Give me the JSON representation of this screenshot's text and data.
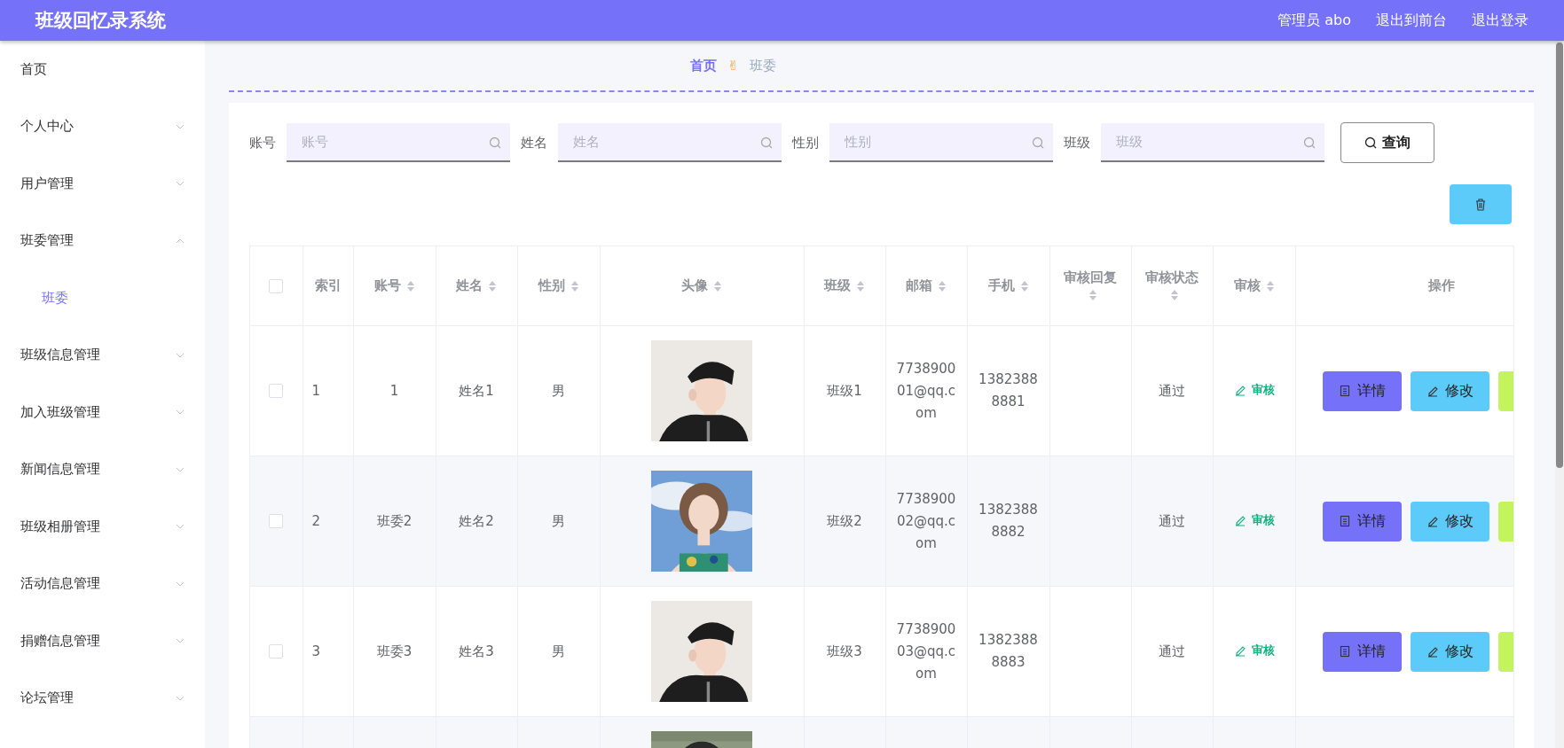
{
  "header": {
    "title": "班级回忆录系统",
    "links": [
      "管理员 abo",
      "退出到前台",
      "退出登录"
    ]
  },
  "sidebar": {
    "items": [
      {
        "label": "首页",
        "kind": "link"
      },
      {
        "label": "个人中心",
        "kind": "menu",
        "expanded": false
      },
      {
        "label": "用户管理",
        "kind": "menu",
        "expanded": false
      },
      {
        "label": "班委管理",
        "kind": "menu",
        "expanded": true,
        "children": [
          {
            "label": "班委",
            "selected": true
          }
        ]
      },
      {
        "label": "班级信息管理",
        "kind": "menu",
        "expanded": false
      },
      {
        "label": "加入班级管理",
        "kind": "menu",
        "expanded": false
      },
      {
        "label": "新闻信息管理",
        "kind": "menu",
        "expanded": false
      },
      {
        "label": "班级相册管理",
        "kind": "menu",
        "expanded": false
      },
      {
        "label": "活动信息管理",
        "kind": "menu",
        "expanded": false
      },
      {
        "label": "捐赠信息管理",
        "kind": "menu",
        "expanded": false
      },
      {
        "label": "论坛管理",
        "kind": "menu",
        "expanded": false
      }
    ]
  },
  "breadcrumb": {
    "items": [
      {
        "label": "首页",
        "selected": true
      },
      {
        "label": "班委",
        "selected": false
      }
    ],
    "separator": "✌"
  },
  "search": {
    "fields": [
      {
        "label": "账号",
        "placeholder": "账号"
      },
      {
        "label": "姓名",
        "placeholder": "姓名"
      },
      {
        "label": "性别",
        "placeholder": "性别"
      },
      {
        "label": "班级",
        "placeholder": "班级"
      }
    ],
    "button": "查询"
  },
  "table": {
    "select_all": {
      "checked": false
    },
    "columns": [
      {
        "label": "索引",
        "sortable": false
      },
      {
        "label": "账号",
        "sortable": true
      },
      {
        "label": "姓名",
        "sortable": true
      },
      {
        "label": "性别",
        "sortable": true
      },
      {
        "label": "头像",
        "sortable": true
      },
      {
        "label": "班级",
        "sortable": true
      },
      {
        "label": "邮箱",
        "sortable": true
      },
      {
        "label": "手机",
        "sortable": true
      },
      {
        "label": "审核回复",
        "sortable": true
      },
      {
        "label": "审核状态",
        "sortable": true
      },
      {
        "label": "审核",
        "sortable": true
      },
      {
        "label": "操作",
        "sortable": false
      }
    ],
    "rows": [
      {
        "checked": false,
        "index": "1",
        "account": "1",
        "name": "姓名1",
        "gender": "男",
        "avatar": {
          "kind": "picture"
        },
        "class": "班级1",
        "email": "773890001@qq.com",
        "phone": "13823888881",
        "status": "通过",
        "review": "审核",
        "actions": [
          "详情",
          "修改"
        ]
      },
      {
        "checked": false,
        "index": "2",
        "account": "班委2",
        "name": "姓名2",
        "gender": "男",
        "avatar": {
          "kind": "picture"
        },
        "class": "班级2",
        "email": "773890002@qq.com",
        "phone": "13823888882",
        "status": "通过",
        "review": "审核",
        "actions": [
          "详情",
          "修改"
        ]
      },
      {
        "checked": false,
        "index": "3",
        "account": "班委3",
        "name": "姓名3",
        "gender": "男",
        "avatar": {
          "kind": "picture"
        },
        "class": "班级3",
        "email": "773890003@qq.com",
        "phone": "13823888883",
        "status": "通过",
        "review": "审核",
        "actions": [
          "详情",
          "修改"
        ]
      },
      {
        "avatar": {
          "kind": "picture"
        }
      }
    ]
  }
}
